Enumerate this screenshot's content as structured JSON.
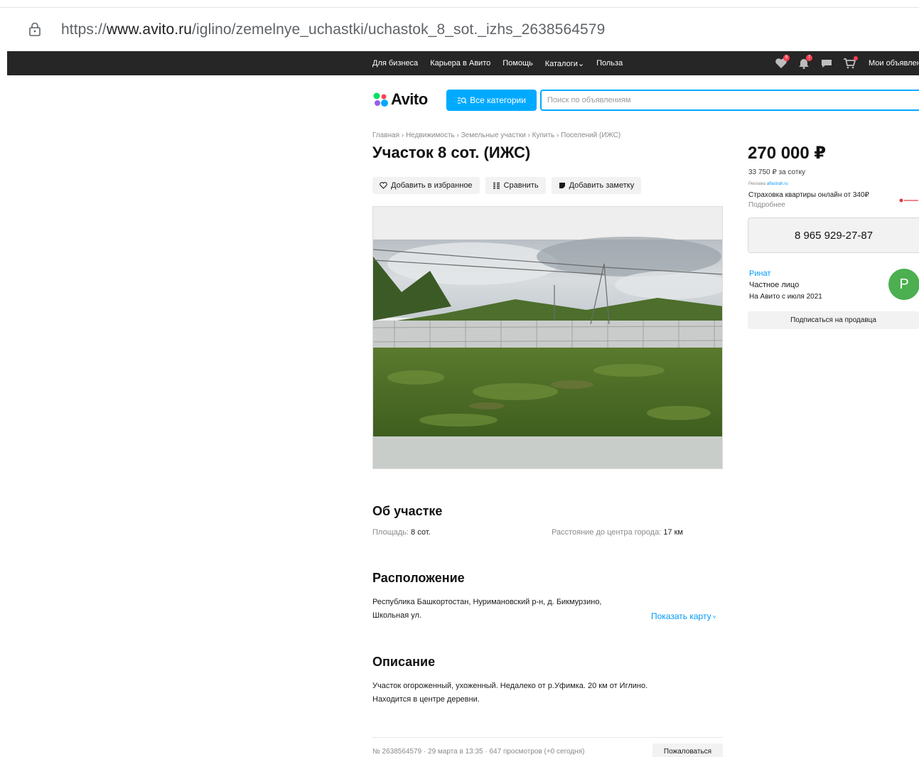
{
  "browser": {
    "url_prefix": "https://",
    "url_domain": "www.avito.ru",
    "url_path": "/iglino/zemelnye_uchastki/uchastok_8_sot._izhs_2638564579",
    "lock_icon": "lock-icon"
  },
  "topnav": {
    "links": [
      "Для бизнеса",
      "Карьера в Авито",
      "Помощь",
      "Каталоги",
      "Польза"
    ],
    "catalog_chevron": "⌄",
    "icons": [
      {
        "name": "favorites-icon",
        "badge": "5"
      },
      {
        "name": "notifications-icon",
        "badge": "7"
      },
      {
        "name": "messages-icon",
        "badge": ""
      },
      {
        "name": "cart-icon",
        "badge": ""
      }
    ],
    "my_ads": "Мои объявления",
    "bg_color": "#262626"
  },
  "header": {
    "logo_text": "Avito",
    "categories_button": "Все категории",
    "search_placeholder": "Поиск по объявлениям",
    "accent_color": "#00aaff"
  },
  "listing": {
    "breadcrumbs": "Главная › Недвижимость › Земельные участки › Купить › Поселений (ИЖС)",
    "title": "Участок 8 сот. (ИЖС)",
    "actions": {
      "favorite": "Добавить в избранное",
      "compare": "Сравнить",
      "note": "Добавить заметку"
    },
    "about": {
      "heading": "Об участке",
      "area_label": "Площадь:",
      "area_value": "8 сот.",
      "distance_label": "Расстояние до центра города:",
      "distance_value": "17 км"
    },
    "location": {
      "heading": "Расположение",
      "address_line1": "Республика Башкортостан, Нуримановский р-н, д. Бикмурзино,",
      "address_line2": "Школьная ул.",
      "show_map": "Показать карту"
    },
    "description": {
      "heading": "Описание",
      "line1": "Участок огороженный, ухоженный. Недалеко от р.Уфимка. 20 км от Иглино.",
      "line2": "Находится в центре деревни."
    },
    "footer": {
      "meta": "№ 2638564579 · 29 марта в 13:35 · 647 просмотров (+0 сегодня)",
      "report": "Пожаловаться"
    }
  },
  "sidebar": {
    "price": "270 000 ₽",
    "price_per": "33 750 ₽ за сотку",
    "ad_label": "Реклама",
    "ad_domain": "alfastrah.ru",
    "ad_text": "Страховка квартиры онлайн от 340₽",
    "ad_more": "Подробнее",
    "phone": "8 965 929-27-87",
    "seller_name": "Ринат",
    "seller_type": "Частное лицо",
    "seller_since": "На Авито с июля 2021",
    "avatar_letter": "Р",
    "subscribe": "Подписаться на продавца"
  }
}
